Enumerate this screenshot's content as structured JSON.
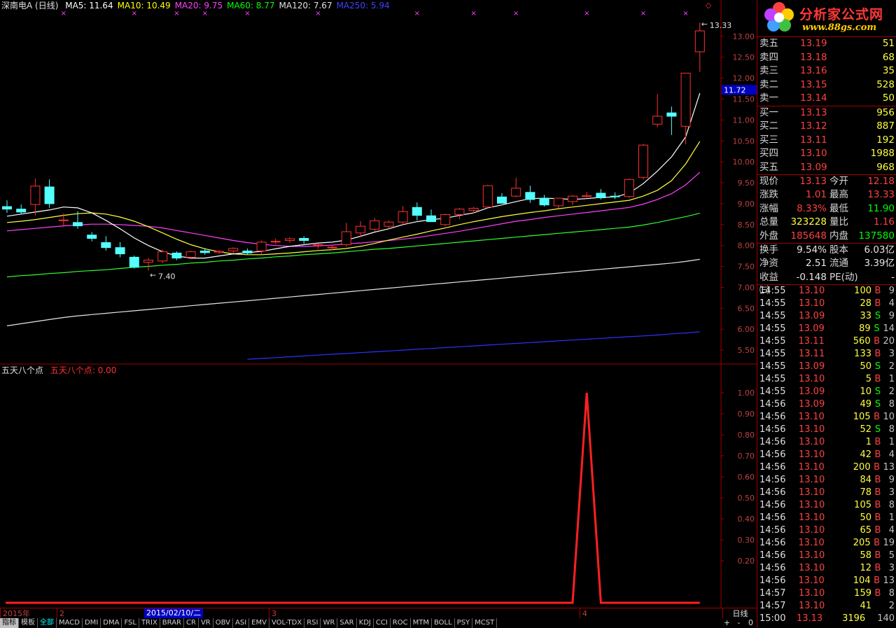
{
  "legend": {
    "stock": "深南电A (日线)",
    "ma": [
      {
        "label": "MA5: 11.64",
        "color": "#ffffff"
      },
      {
        "label": "MA10: 10.49",
        "color": "#ffff00"
      },
      {
        "label": "MA20: 9.75",
        "color": "#ff40ff"
      },
      {
        "label": "MA60: 8.77",
        "color": "#00ff00"
      },
      {
        "label": "MA120: 7.67",
        "color": "#e0e0e0"
      },
      {
        "label": "MA250: 5.94",
        "color": "#4040ff"
      }
    ]
  },
  "chart_labels": {
    "high": "13.33",
    "low": "7.40",
    "current_price_tag": "11.72"
  },
  "price_axis": [
    "13.00",
    "12.50",
    "12.00",
    "11.50",
    "11.00",
    "10.50",
    "10.00",
    "9.50",
    "9.00",
    "8.50",
    "8.00",
    "7.50",
    "7.00",
    "6.50",
    "6.00",
    "5.50"
  ],
  "indicator": {
    "name": "五天八个点",
    "value_label": "五天八个点: 0.00",
    "axis": [
      "1.00",
      "0.90",
      "0.80",
      "0.70",
      "0.60",
      "0.50",
      "0.40",
      "0.30",
      "0.20"
    ]
  },
  "chart_data": {
    "type": "candlestick",
    "ylim": [
      5.2,
      13.6
    ],
    "ohlc": [
      [
        8.93,
        9.08,
        8.78,
        8.87
      ],
      [
        8.87,
        8.98,
        8.75,
        8.8
      ],
      [
        8.98,
        9.6,
        8.72,
        9.42
      ],
      [
        9.4,
        9.58,
        8.9,
        9.0
      ],
      [
        8.6,
        8.77,
        8.45,
        8.61
      ],
      [
        8.55,
        8.82,
        8.4,
        8.47
      ],
      [
        8.25,
        8.32,
        8.1,
        8.17
      ],
      [
        8.07,
        8.22,
        7.88,
        7.95
      ],
      [
        7.95,
        8.08,
        7.72,
        7.8
      ],
      [
        7.72,
        7.76,
        7.45,
        7.48
      ],
      [
        7.6,
        7.7,
        7.4,
        7.65
      ],
      [
        7.63,
        7.9,
        7.58,
        7.85
      ],
      [
        7.82,
        7.86,
        7.65,
        7.7
      ],
      [
        7.72,
        7.88,
        7.67,
        7.85
      ],
      [
        7.87,
        7.94,
        7.78,
        7.83
      ],
      [
        7.84,
        7.89,
        7.79,
        7.86
      ],
      [
        7.87,
        7.96,
        7.81,
        7.93
      ],
      [
        7.87,
        7.93,
        7.78,
        7.82
      ],
      [
        7.87,
        8.12,
        7.78,
        8.08
      ],
      [
        8.1,
        8.17,
        8.03,
        8.1
      ],
      [
        8.12,
        8.2,
        8.06,
        8.16
      ],
      [
        8.17,
        8.22,
        8.04,
        8.12
      ],
      [
        8.0,
        8.05,
        7.92,
        8.02
      ],
      [
        7.96,
        8.01,
        7.89,
        7.96
      ],
      [
        8.02,
        8.54,
        7.97,
        8.33
      ],
      [
        8.3,
        8.58,
        8.2,
        8.46
      ],
      [
        8.39,
        8.66,
        8.34,
        8.59
      ],
      [
        8.46,
        8.6,
        8.4,
        8.56
      ],
      [
        8.56,
        8.94,
        8.5,
        8.81
      ],
      [
        8.91,
        9.03,
        8.6,
        8.72
      ],
      [
        8.71,
        8.86,
        8.6,
        8.57
      ],
      [
        8.5,
        8.76,
        8.46,
        8.74
      ],
      [
        8.74,
        8.9,
        8.63,
        8.87
      ],
      [
        8.84,
        8.92,
        8.77,
        8.89
      ],
      [
        8.92,
        9.45,
        8.89,
        9.43
      ],
      [
        9.16,
        9.25,
        9.01,
        9.01
      ],
      [
        9.18,
        9.62,
        9.15,
        9.37
      ],
      [
        9.27,
        9.43,
        9.02,
        9.1
      ],
      [
        9.13,
        9.21,
        8.93,
        8.97
      ],
      [
        8.95,
        9.14,
        8.89,
        9.13
      ],
      [
        9.05,
        9.21,
        8.97,
        9.18
      ],
      [
        9.17,
        9.28,
        9.14,
        9.19
      ],
      [
        9.25,
        9.35,
        9.1,
        9.14
      ],
      [
        9.18,
        9.27,
        9.11,
        9.17
      ],
      [
        9.17,
        9.6,
        9.14,
        9.58
      ],
      [
        9.63,
        10.43,
        9.58,
        10.4
      ],
      [
        10.9,
        11.62,
        10.83,
        11.09
      ],
      [
        11.17,
        11.32,
        10.64,
        11.09
      ],
      [
        10.85,
        12.12,
        10.42,
        12.12
      ],
      [
        12.63,
        13.33,
        12.15,
        13.13
      ]
    ],
    "ma5": [
      8.7,
      8.75,
      8.8,
      8.85,
      8.92,
      8.9,
      8.78,
      8.6,
      8.4,
      8.18,
      8.0,
      7.85,
      7.75,
      7.7,
      7.7,
      7.75,
      7.8,
      7.83,
      7.86,
      7.92,
      7.98,
      8.02,
      8.06,
      8.08,
      8.13,
      8.22,
      8.32,
      8.4,
      8.5,
      8.57,
      8.62,
      8.65,
      8.72,
      8.78,
      8.9,
      8.97,
      9.05,
      9.12,
      9.13,
      9.12,
      9.1,
      9.12,
      9.15,
      9.16,
      9.25,
      9.48,
      9.78,
      10.12,
      10.6,
      11.64
    ],
    "ma10": [
      8.55,
      8.58,
      8.62,
      8.67,
      8.72,
      8.76,
      8.78,
      8.75,
      8.68,
      8.58,
      8.45,
      8.3,
      8.15,
      8.02,
      7.92,
      7.85,
      7.8,
      7.78,
      7.78,
      7.8,
      7.82,
      7.85,
      7.88,
      7.9,
      7.93,
      7.98,
      8.05,
      8.13,
      8.2,
      8.27,
      8.35,
      8.42,
      8.5,
      8.57,
      8.63,
      8.69,
      8.74,
      8.79,
      8.83,
      8.88,
      8.92,
      8.96,
      9.0,
      9.04,
      9.08,
      9.18,
      9.32,
      9.55,
      9.95,
      10.49
    ],
    "ma20": [
      8.35,
      8.38,
      8.41,
      8.44,
      8.47,
      8.49,
      8.51,
      8.51,
      8.5,
      8.48,
      8.46,
      8.42,
      8.36,
      8.3,
      8.24,
      8.18,
      8.12,
      8.07,
      8.03,
      8.0,
      7.98,
      7.98,
      7.99,
      8.01,
      8.04,
      8.06,
      8.09,
      8.12,
      8.15,
      8.19,
      8.24,
      8.29,
      8.34,
      8.4,
      8.46,
      8.52,
      8.58,
      8.62,
      8.67,
      8.71,
      8.75,
      8.79,
      8.83,
      8.87,
      8.91,
      8.99,
      9.1,
      9.24,
      9.45,
      9.75
    ],
    "ma60": [
      7.25,
      7.28,
      7.3,
      7.33,
      7.35,
      7.38,
      7.4,
      7.42,
      7.45,
      7.48,
      7.5,
      7.53,
      7.55,
      7.58,
      7.6,
      7.63,
      7.65,
      7.68,
      7.7,
      7.73,
      7.75,
      7.78,
      7.8,
      7.82,
      7.85,
      7.88,
      7.91,
      7.93,
      7.96,
      7.99,
      8.02,
      8.05,
      8.08,
      8.11,
      8.14,
      8.17,
      8.2,
      8.23,
      8.26,
      8.29,
      8.32,
      8.35,
      8.38,
      8.41,
      8.44,
      8.49,
      8.55,
      8.62,
      8.69,
      8.77
    ],
    "ma120": [
      6.08,
      6.13,
      6.18,
      6.23,
      6.28,
      6.32,
      6.35,
      6.38,
      6.41,
      6.44,
      6.47,
      6.5,
      6.53,
      6.56,
      6.59,
      6.62,
      6.65,
      6.68,
      6.71,
      6.74,
      6.77,
      6.8,
      6.83,
      6.86,
      6.89,
      6.92,
      6.95,
      6.98,
      7.01,
      7.04,
      7.07,
      7.1,
      7.13,
      7.16,
      7.19,
      7.22,
      7.25,
      7.28,
      7.31,
      7.34,
      7.37,
      7.4,
      7.43,
      7.46,
      7.49,
      7.52,
      7.55,
      7.58,
      7.62,
      7.67
    ],
    "ma250_start_index": 17,
    "ma250": [
      5.28,
      5.3,
      5.32,
      5.34,
      5.36,
      5.38,
      5.4,
      5.42,
      5.44,
      5.46,
      5.48,
      5.5,
      5.52,
      5.54,
      5.56,
      5.58,
      5.6,
      5.62,
      5.64,
      5.66,
      5.68,
      5.7,
      5.72,
      5.74,
      5.76,
      5.78,
      5.8,
      5.82,
      5.84,
      5.86,
      5.89,
      5.91,
      5.94
    ],
    "signal_marks": [
      4,
      9,
      12,
      14,
      17,
      22,
      29,
      33,
      36,
      41,
      45,
      48
    ],
    "indicator_values": [
      0,
      0,
      0,
      0,
      0,
      0,
      0,
      0,
      0,
      0,
      0,
      0,
      0,
      0,
      0,
      0,
      0,
      0,
      0,
      0,
      0,
      0,
      0,
      0,
      0,
      0,
      0,
      0,
      0,
      0,
      0,
      0,
      0,
      0,
      0,
      0,
      0,
      0,
      0,
      0,
      0,
      1,
      0,
      0,
      0,
      0,
      0,
      0,
      0,
      0
    ],
    "indicator_ylim": [
      0,
      1.08
    ]
  },
  "x_axis": {
    "ticks": [
      {
        "label": "2015年",
        "i": 0
      },
      {
        "label": "2",
        "i": 4
      },
      {
        "label": "3",
        "i": 19
      },
      {
        "label": "4",
        "i": 41
      }
    ],
    "selected": "2015/02/10/二",
    "period": "日线"
  },
  "quote": {
    "asks": [
      {
        "label": "卖五",
        "price": "13.19",
        "vol": "51"
      },
      {
        "label": "卖四",
        "price": "13.18",
        "vol": "68"
      },
      {
        "label": "卖三",
        "price": "13.16",
        "vol": "35"
      },
      {
        "label": "卖二",
        "price": "13.15",
        "vol": "528"
      },
      {
        "label": "卖一",
        "price": "13.14",
        "vol": "50"
      }
    ],
    "bids": [
      {
        "label": "买一",
        "price": "13.13",
        "vol": "956"
      },
      {
        "label": "买二",
        "price": "13.12",
        "vol": "887"
      },
      {
        "label": "买三",
        "price": "13.11",
        "vol": "192"
      },
      {
        "label": "买四",
        "price": "13.10",
        "vol": "1988"
      },
      {
        "label": "买五",
        "price": "13.09",
        "vol": "968"
      }
    ]
  },
  "stats": [
    {
      "l1": "现价",
      "v1": "13.13",
      "c1": "red",
      "l2": "今开",
      "v2": "12.18",
      "c2": "red"
    },
    {
      "l1": "涨跌",
      "v1": "1.01",
      "c1": "red",
      "l2": "最高",
      "v2": "13.33",
      "c2": "red"
    },
    {
      "l1": "涨幅",
      "v1": "8.33%",
      "c1": "red",
      "l2": "最低",
      "v2": "11.90",
      "c2": "green"
    },
    {
      "l1": "总量",
      "v1": "323228",
      "c1": "yellow",
      "l2": "量比",
      "v2": "1.16",
      "c2": "red"
    },
    {
      "l1": "外盘",
      "v1": "185648",
      "c1": "red",
      "l2": "内盘",
      "v2": "137580",
      "c2": "green"
    }
  ],
  "stats2": [
    {
      "l1": "换手",
      "v1": "9.54%",
      "c1": "white",
      "l2": "股本",
      "v2": "6.03亿",
      "c2": "white"
    },
    {
      "l1": "净资",
      "v1": "2.51",
      "c1": "white",
      "l2": "流通",
      "v2": "3.39亿",
      "c2": "white"
    },
    {
      "l1": "收益㈢",
      "v1": "-0.148",
      "c1": "white",
      "l2": "PE(动)",
      "v2": "-",
      "c2": "white"
    }
  ],
  "ticks": [
    {
      "t": "14:55",
      "p": "13.10",
      "v": "100",
      "bs": "B",
      "n": "9"
    },
    {
      "t": "14:55",
      "p": "13.10",
      "v": "28",
      "bs": "B",
      "n": "4"
    },
    {
      "t": "14:55",
      "p": "13.09",
      "v": "33",
      "bs": "S",
      "n": "9"
    },
    {
      "t": "14:55",
      "p": "13.09",
      "v": "89",
      "bs": "S",
      "n": "14"
    },
    {
      "t": "14:55",
      "p": "13.11",
      "v": "560",
      "bs": "B",
      "n": "20",
      "vc": "purple"
    },
    {
      "t": "14:55",
      "p": "13.11",
      "v": "133",
      "bs": "B",
      "n": "3"
    },
    {
      "t": "14:55",
      "p": "13.09",
      "v": "50",
      "bs": "S",
      "n": "2"
    },
    {
      "t": "14:55",
      "p": "13.10",
      "v": "5",
      "bs": "B",
      "n": "1"
    },
    {
      "t": "14:55",
      "p": "13.09",
      "v": "10",
      "bs": "S",
      "n": "2"
    },
    {
      "t": "14:56",
      "p": "13.09",
      "v": "49",
      "bs": "S",
      "n": "8"
    },
    {
      "t": "14:56",
      "p": "13.10",
      "v": "105",
      "bs": "B",
      "n": "10"
    },
    {
      "t": "14:56",
      "p": "13.10",
      "v": "52",
      "bs": "S",
      "n": "8"
    },
    {
      "t": "14:56",
      "p": "13.10",
      "v": "1",
      "bs": "B",
      "n": "1"
    },
    {
      "t": "14:56",
      "p": "13.10",
      "v": "42",
      "bs": "B",
      "n": "4"
    },
    {
      "t": "14:56",
      "p": "13.10",
      "v": "200",
      "bs": "B",
      "n": "13"
    },
    {
      "t": "14:56",
      "p": "13.10",
      "v": "84",
      "bs": "B",
      "n": "9"
    },
    {
      "t": "14:56",
      "p": "13.10",
      "v": "78",
      "bs": "B",
      "n": "3"
    },
    {
      "t": "14:56",
      "p": "13.10",
      "v": "105",
      "bs": "B",
      "n": "8"
    },
    {
      "t": "14:56",
      "p": "13.10",
      "v": "50",
      "bs": "B",
      "n": "1"
    },
    {
      "t": "14:56",
      "p": "13.10",
      "v": "65",
      "bs": "B",
      "n": "4"
    },
    {
      "t": "14:56",
      "p": "13.10",
      "v": "205",
      "bs": "B",
      "n": "19"
    },
    {
      "t": "14:56",
      "p": "13.10",
      "v": "58",
      "bs": "B",
      "n": "5"
    },
    {
      "t": "14:56",
      "p": "13.10",
      "v": "12",
      "bs": "B",
      "n": "3"
    },
    {
      "t": "14:56",
      "p": "13.10",
      "v": "104",
      "bs": "B",
      "n": "13"
    },
    {
      "t": "14:57",
      "p": "13.10",
      "v": "159",
      "bs": "B",
      "n": "8"
    },
    {
      "t": "14:57",
      "p": "13.10",
      "v": "41",
      "bs": "",
      "n": "2"
    },
    {
      "t": "15:00",
      "p": "13.13",
      "v": "3196",
      "bs": "",
      "n": "140",
      "vc": "purple"
    }
  ],
  "tabs": [
    "指标",
    "模板",
    "全部",
    "MACD",
    "DMI",
    "DMA",
    "FSL",
    "TRIX",
    "BRAR",
    "CR",
    "VR",
    "OBV",
    "ASI",
    "EMV",
    "VOL-TDX",
    "RSI",
    "WR",
    "SAR",
    "KDJ",
    "CCI",
    "ROC",
    "MTM",
    "BOLL",
    "PSY",
    "MCST"
  ],
  "active_tab": "指标",
  "current_tab": "全部",
  "controls": [
    "+",
    "-",
    "0"
  ],
  "logo": {
    "title": "分析家公式网",
    "url": "www.88gs.com"
  }
}
